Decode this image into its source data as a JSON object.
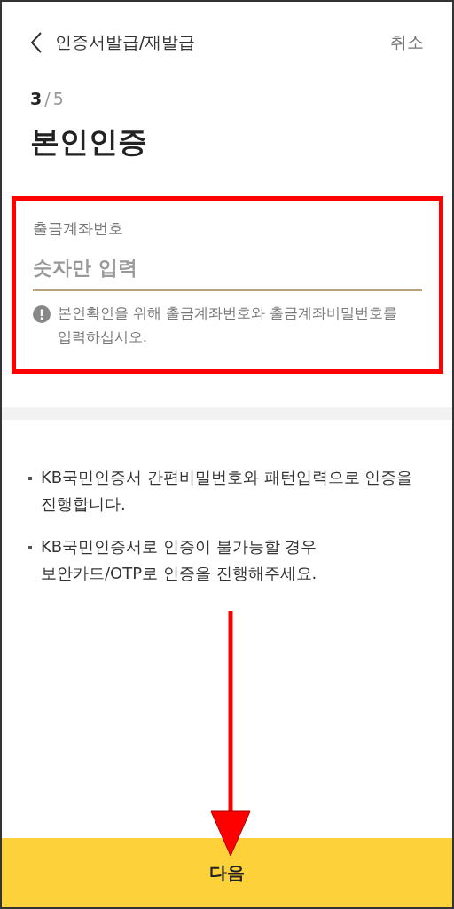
{
  "header": {
    "title": "인증서발급/재발급",
    "cancel": "취소"
  },
  "step": {
    "current": "3",
    "separator": "/",
    "total": "5"
  },
  "title": "본인인증",
  "account_field": {
    "label": "출금계좌번호",
    "placeholder": "숫자만 입력",
    "notice": "본인확인을 위해 출금계좌번호와 출금계좌비밀번호를 입력하십시오."
  },
  "notes": [
    "KB국민인증서 간편비밀번호와 패턴입력으로 인증을 진행합니다.",
    "KB국민인증서로 인증이 불가능할 경우 보안카드/OTP로 인증을 진행해주세요."
  ],
  "next_button": "다음"
}
